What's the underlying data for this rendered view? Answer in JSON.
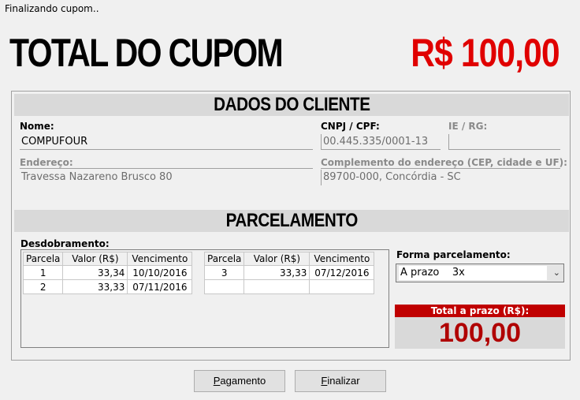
{
  "window": {
    "title": "Finalizando cupom.."
  },
  "header": {
    "total_label": "TOTAL DO CUPOM",
    "total_value": "R$ 100,00"
  },
  "client": {
    "section_title": "DADOS DO CLIENTE",
    "name_label": "Nome:",
    "name_value": "COMPUFOUR",
    "cnpj_label": "CNPJ / CPF:",
    "cnpj_value": "00.445.335/0001-13",
    "ie_label": "IE / RG:",
    "ie_value": "",
    "address_label": "Endereço:",
    "address_value": "Travessa Nazareno Brusco 80",
    "complement_label": "Complemento do endereço (CEP, cidade e UF):",
    "complement_value": "89700-000, Concórdia - SC"
  },
  "installments": {
    "section_title": "PARCELAMENTO",
    "breakdown_label": "Desdobramento:",
    "columns": [
      "Parcela",
      "Valor (R$)",
      "Vencimento"
    ],
    "left_rows": [
      {
        "parcela": "1",
        "valor": "33,34",
        "vencimento": "10/10/2016"
      },
      {
        "parcela": "2",
        "valor": "33,33",
        "vencimento": "07/11/2016"
      }
    ],
    "right_rows": [
      {
        "parcela": "3",
        "valor": "33,33",
        "vencimento": "07/12/2016"
      },
      {
        "parcela": "",
        "valor": "",
        "vencimento": ""
      }
    ],
    "form_label": "Forma parcelamento:",
    "form_value": "A prazo    3x",
    "total_label": "Total a prazo (R$):",
    "total_value": "100,00"
  },
  "buttons": {
    "payment_first": "P",
    "payment_rest": "agamento",
    "finish_first": "F",
    "finish_rest": "inalizar"
  },
  "icons": {
    "dropdown": "chevron-down-icon"
  },
  "colors": {
    "accent_red": "#e00000",
    "header_red": "#c00000"
  }
}
